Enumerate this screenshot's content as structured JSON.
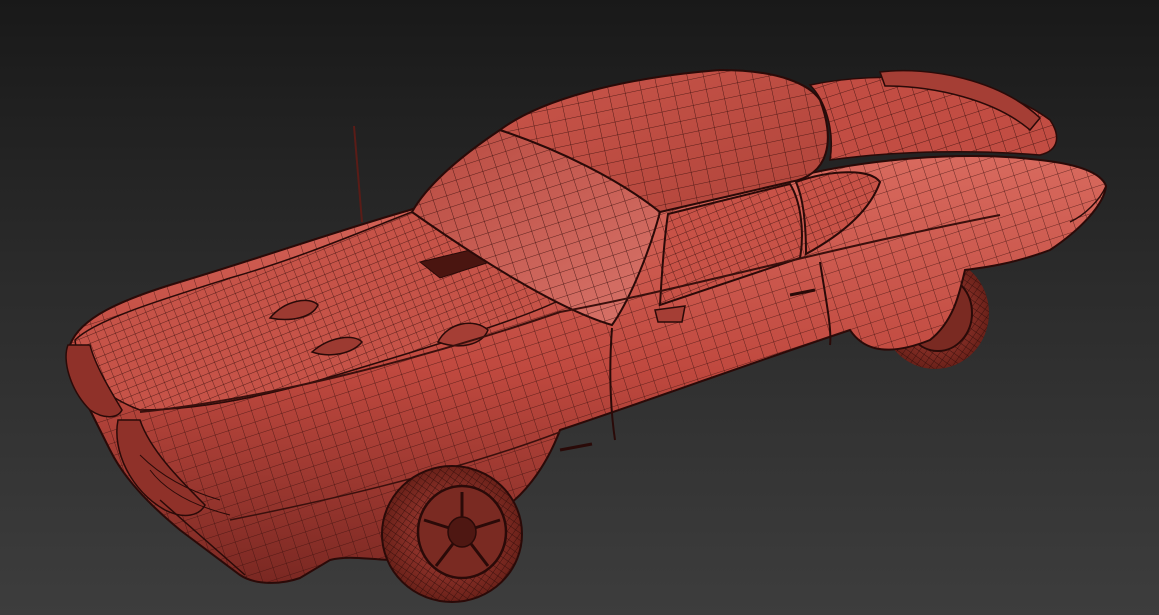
{
  "viewport": {
    "description_label": "",
    "background_top": "#191919",
    "background_bottom": "#3d3d3d"
  },
  "model": {
    "shading_mode": "wireframe-on-shaded",
    "body_color": "#c0493f",
    "body_highlight": "#d8675c",
    "body_shadow": "#7a2822",
    "wire_color": "#3a100d"
  }
}
